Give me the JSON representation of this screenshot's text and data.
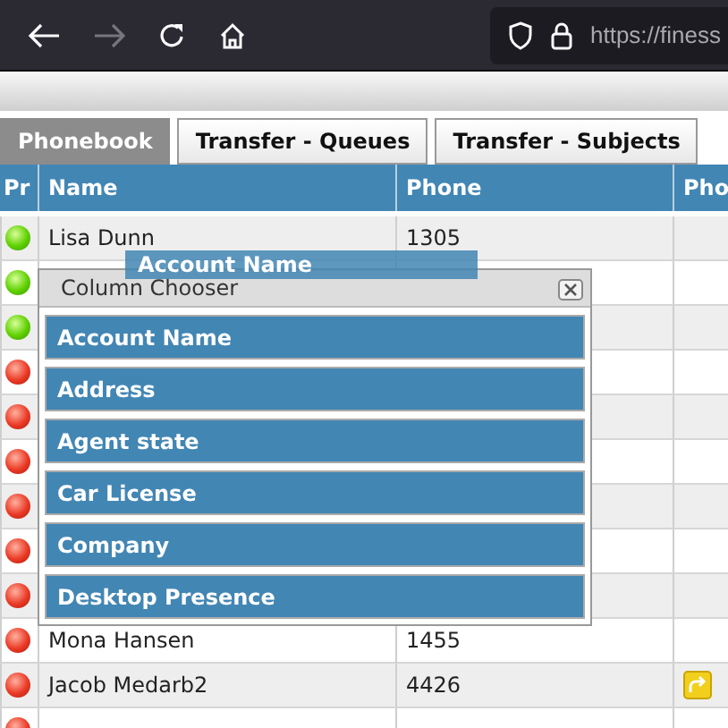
{
  "browser": {
    "url": "https://finess",
    "forward_disabled": true
  },
  "tabs": [
    {
      "label": "Phonebook",
      "selected": true
    },
    {
      "label": "Transfer - Queues",
      "selected": false
    },
    {
      "label": "Transfer - Subjects",
      "selected": false
    }
  ],
  "table": {
    "columns": [
      "Pr",
      "Name",
      "Phone",
      "Pho"
    ],
    "rows": [
      {
        "online": true,
        "name": "Lisa Dunn",
        "phone": "1305",
        "transfer": false
      },
      {
        "online": true,
        "transfer": false
      },
      {
        "online": true,
        "transfer": false
      },
      {
        "online": false,
        "transfer": false
      },
      {
        "online": false,
        "transfer": false
      },
      {
        "online": false,
        "transfer": false
      },
      {
        "online": false,
        "transfer": false
      },
      {
        "online": false,
        "transfer": false
      },
      {
        "online": false,
        "transfer": false
      },
      {
        "online": false,
        "name": "Mona Hansen",
        "phone": "1455",
        "transfer": false
      },
      {
        "online": false,
        "name": "Jacob Medarb2",
        "phone": "4426",
        "transfer": true
      },
      {
        "online": false,
        "transfer": false
      }
    ]
  },
  "column_chooser": {
    "title": "Column Chooser",
    "items": [
      "Account Name",
      "Address",
      "Agent state",
      "Car License",
      "Company",
      "Desktop Presence"
    ],
    "dragged_item": "Account Name"
  }
}
